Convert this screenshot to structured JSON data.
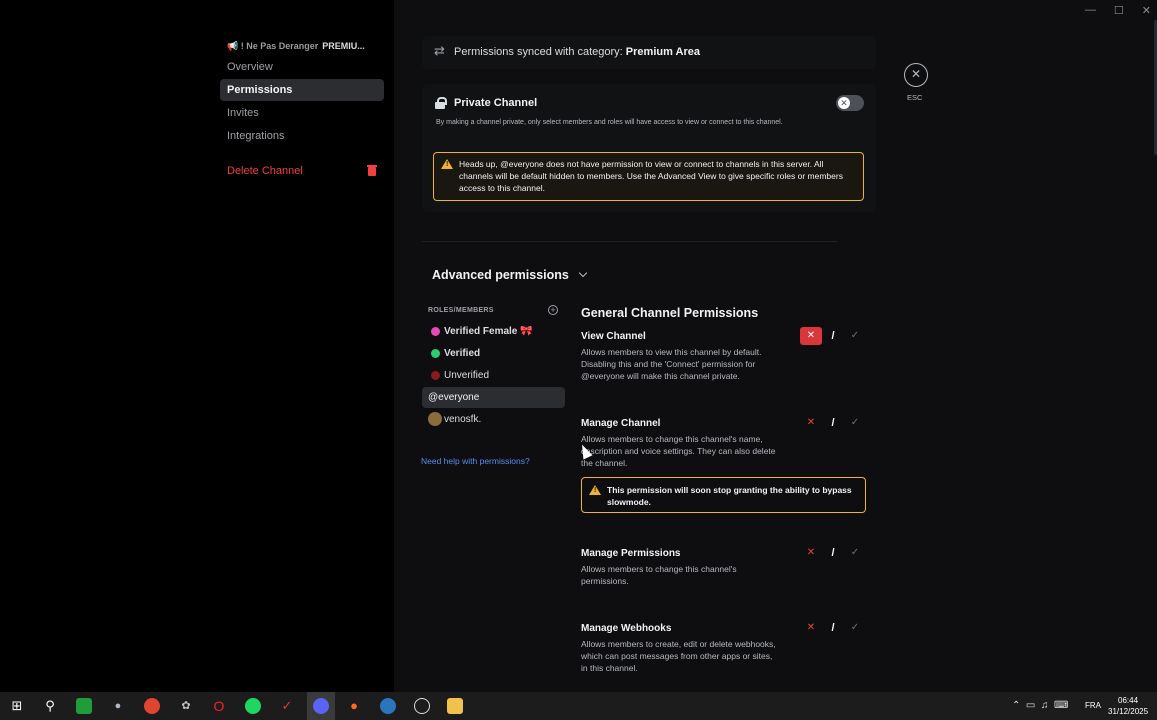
{
  "sidebar": {
    "channel_header": "📢 ! Ne Pas Deranger",
    "channel_tag": "PREMIU...",
    "items": [
      {
        "label": "Overview"
      },
      {
        "label": "Permissions"
      },
      {
        "label": "Invites"
      },
      {
        "label": "Integrations"
      }
    ],
    "delete_label": "Delete Channel"
  },
  "sync": {
    "prefix": "Permissions synced with category: ",
    "category": "Premium Area"
  },
  "private_channel": {
    "title": "Private Channel",
    "description": "By making a channel private, only select members and roles will have access to view or connect to this channel.",
    "toggle_state": "off",
    "warning": "Heads up, @everyone does not have permission to view or connect to channels in this server. All channels will be default hidden to members. Use the Advanced View to give specific roles or members access to this channel."
  },
  "advanced": {
    "title": "Advanced permissions",
    "roles_label": "ROLES/MEMBERS",
    "roles": [
      {
        "name": "Verified Female 🎀",
        "color": "#e84ab5"
      },
      {
        "name": "Verified",
        "color": "#2ecc71"
      },
      {
        "name": "Unverified",
        "color": "#8b1a1a"
      },
      {
        "name": "@everyone"
      },
      {
        "name": "venosfk."
      }
    ],
    "help_link": "Need help with permissions?"
  },
  "general": {
    "title": "General Channel Permissions",
    "permissions": [
      {
        "name": "View Channel",
        "description": "Allows members to view this channel by default. Disabling this and the 'Connect' permission for @everyone will make this channel private.",
        "state": "deny"
      },
      {
        "name": "Manage Channel",
        "description": "Allows members to change this channel's name, description and voice settings. They can also delete the channel.",
        "state": "neutral"
      },
      {
        "name": "Manage Permissions",
        "description": "Allows members to change this channel's permissions.",
        "state": "neutral"
      },
      {
        "name": "Manage Webhooks",
        "description": "Allows members to create, edit or delete webhooks, which can post messages from other apps or sites, in this channel.",
        "state": "neutral"
      }
    ],
    "manage_channel_warning": "This permission will soon stop granting the ability to bypass slowmode."
  },
  "esc": {
    "label": "ESC"
  },
  "controls": {
    "deny": "✕",
    "neutral": "/",
    "allow": "✓",
    "close": "✕"
  },
  "taskbar": {
    "language": "FRA",
    "time": "06:44",
    "date": "31/12/2025"
  },
  "colors": {
    "danger": "#f23f42",
    "warning": "#f0b232",
    "link": "#5b8cf0"
  }
}
